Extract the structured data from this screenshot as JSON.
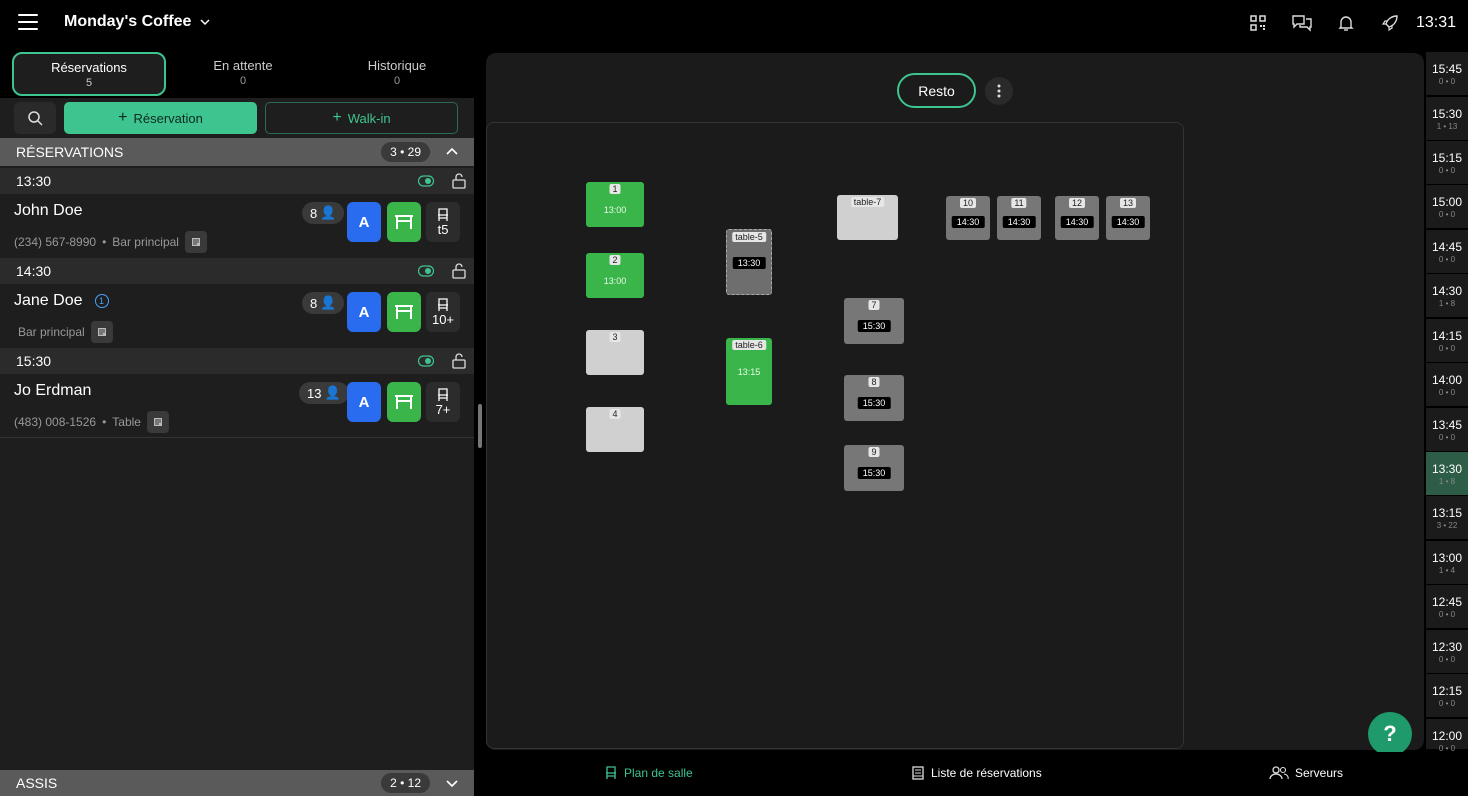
{
  "header": {
    "brand": "Monday's Coffee",
    "clock": "13:31"
  },
  "tabs": [
    {
      "label": "Réservations",
      "count": "5"
    },
    {
      "label": "En attente",
      "count": "0"
    },
    {
      "label": "Historique",
      "count": "0"
    }
  ],
  "actions": {
    "reservation_label": "Réservation",
    "walkin_label": "Walk-in"
  },
  "sections": {
    "reservations": {
      "title": "RÉSERVATIONS",
      "badge": "3 • 29"
    },
    "assis": {
      "title": "ASSIS",
      "badge": "2 • 12"
    }
  },
  "groups": [
    {
      "time": "13:30"
    },
    {
      "time": "14:30"
    },
    {
      "time": "15:30"
    }
  ],
  "reservations": [
    {
      "name": "John Doe",
      "phone": "(234) 567-8990",
      "sep": "•",
      "area": "Bar principal",
      "party": "8",
      "server": "A",
      "seats": "t5",
      "badge": ""
    },
    {
      "name": "Jane Doe",
      "phone": "",
      "sep": "",
      "area": "Bar principal",
      "party": "8",
      "server": "A",
      "seats": "10+",
      "badge": "1"
    },
    {
      "name": "Jo Erdman",
      "phone": "(483) 008-1526",
      "sep": "•",
      "area": "Table",
      "party": "13",
      "server": "A",
      "seats": "7+",
      "badge": ""
    }
  ],
  "floor": {
    "room_button": "Resto",
    "tables": [
      {
        "label": "1",
        "time": "13:00"
      },
      {
        "label": "2",
        "time": "13:00"
      },
      {
        "label": "3",
        "time": ""
      },
      {
        "label": "4",
        "time": ""
      },
      {
        "label": "table-5",
        "time": "13:30"
      },
      {
        "label": "table-6",
        "time": "13:15"
      },
      {
        "label": "table-7",
        "time": ""
      },
      {
        "label": "7",
        "time": "15:30"
      },
      {
        "label": "8",
        "time": "15:30"
      },
      {
        "label": "9",
        "time": "15:30"
      },
      {
        "label": "10",
        "time": "14:30"
      },
      {
        "label": "11",
        "time": "14:30"
      },
      {
        "label": "12",
        "time": "14:30"
      },
      {
        "label": "13",
        "time": "14:30"
      }
    ]
  },
  "timeline": [
    {
      "time": "15:45",
      "count": "0 • 0"
    },
    {
      "time": "15:30",
      "count": "1 • 13"
    },
    {
      "time": "15:15",
      "count": "0 • 0"
    },
    {
      "time": "15:00",
      "count": "0 • 0"
    },
    {
      "time": "14:45",
      "count": "0 • 0"
    },
    {
      "time": "14:30",
      "count": "1 • 8"
    },
    {
      "time": "14:15",
      "count": "0 • 0"
    },
    {
      "time": "14:00",
      "count": "0 • 0"
    },
    {
      "time": "13:45",
      "count": "0 • 0"
    },
    {
      "time": "13:30",
      "count": "1 • 8"
    },
    {
      "time": "13:15",
      "count": "3 • 22"
    },
    {
      "time": "13:00",
      "count": "1 • 4"
    },
    {
      "time": "12:45",
      "count": "0 • 0"
    },
    {
      "time": "12:30",
      "count": "0 • 0"
    },
    {
      "time": "12:15",
      "count": "0 • 0"
    },
    {
      "time": "12:00",
      "count": "0 • 0"
    }
  ],
  "help_label": "?",
  "bottom_nav": {
    "floor_plan": "Plan de salle",
    "list": "Liste de réservations",
    "servers": "Serveurs"
  },
  "colors": {
    "accent": "#3ec48f",
    "server_blue": "#2a6cf0",
    "table_green": "#39b54a"
  }
}
